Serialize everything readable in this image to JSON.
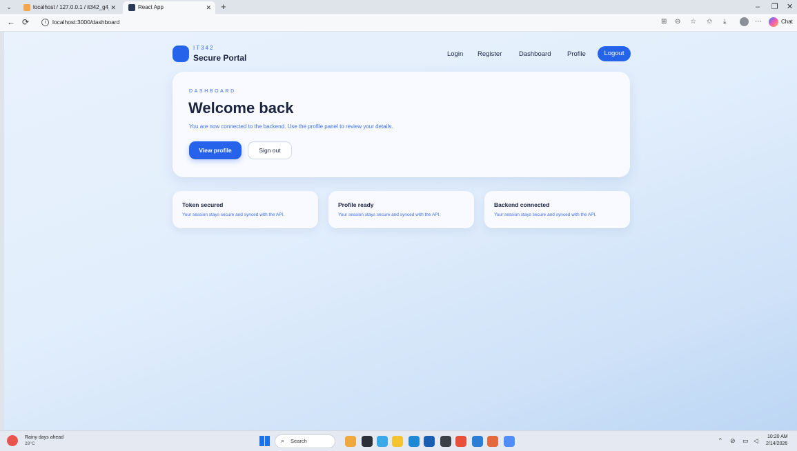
{
  "browser": {
    "tabs": [
      {
        "title": "localhost / 127.0.0.1 / it342_g4_s",
        "close": "✕"
      },
      {
        "title": "React App",
        "close": "✕"
      }
    ],
    "new_tab": "+",
    "dropdown": "⌄",
    "window_controls": {
      "minimize": "–",
      "restore": "❐",
      "close": "✕"
    },
    "nav": {
      "back": "←",
      "reload": "⟳"
    },
    "url": "localhost:3000/dashboard",
    "copilot_label": "Chat"
  },
  "site": {
    "brand": {
      "eyebrow": "IT342",
      "name": "Secure Portal"
    },
    "nav": {
      "login": "Login",
      "register": "Register",
      "dashboard": "Dashboard",
      "profile": "Profile",
      "logout": "Logout"
    }
  },
  "hero": {
    "eyebrow": "DASHBOARD",
    "title": "Welcome back",
    "subtitle": "You are now connected to the backend. Use the profile panel to review your details.",
    "primary_button": "View profile",
    "secondary_button": "Sign out"
  },
  "cards": [
    {
      "title": "Token secured",
      "desc": "Your session stays secure and synced with the API."
    },
    {
      "title": "Profile ready",
      "desc": "Your session stays secure and synced with the API."
    },
    {
      "title": "Backend connected",
      "desc": "Your session stays secure and synced with the API."
    }
  ],
  "taskbar": {
    "weather": {
      "title": "Rainy days ahead",
      "temp": "28°C"
    },
    "search_label": "Search",
    "clock": {
      "time": "10:20 AM",
      "date": "2/14/2026"
    }
  }
}
